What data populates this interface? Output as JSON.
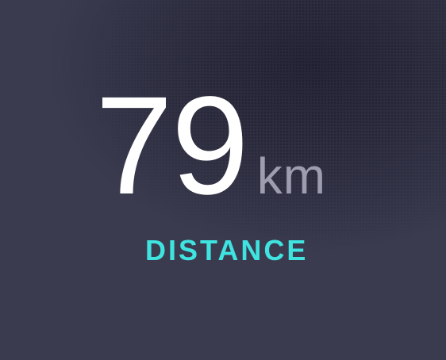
{
  "metric": {
    "value": "79",
    "unit": "km",
    "label": "DISTANCE"
  },
  "colors": {
    "background": "#3b3b50",
    "value": "#ffffff",
    "unit": "#9d9daf",
    "label": "#3fe3e0"
  }
}
